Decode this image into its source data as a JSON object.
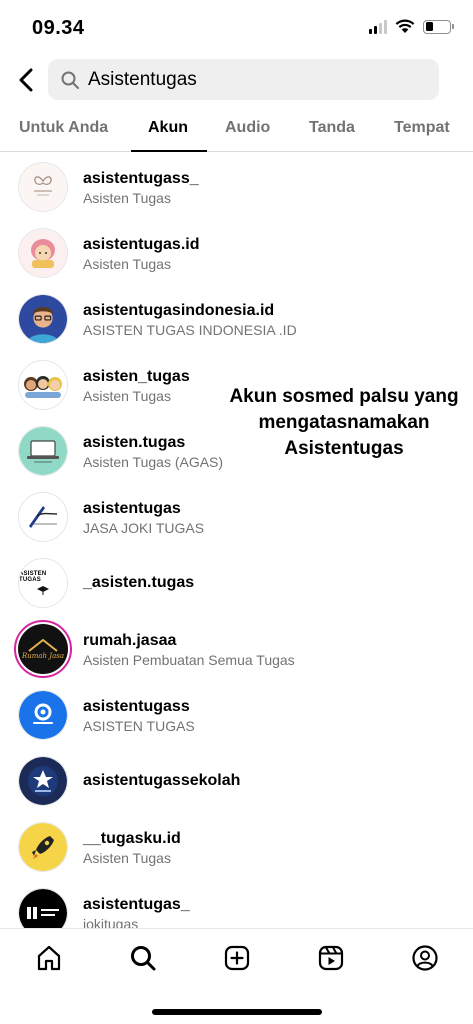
{
  "status_bar": {
    "time": "09.34"
  },
  "search": {
    "query": "Asistentugas"
  },
  "tabs": [
    {
      "label": "Untuk Anda"
    },
    {
      "label": "Akun"
    },
    {
      "label": "Audio"
    },
    {
      "label": "Tanda"
    },
    {
      "label": "Tempat"
    }
  ],
  "results": [
    {
      "username": "asistentugass_",
      "fullname": "Asisten Tugas",
      "avatar_icon": "butterfly-logo-icon"
    },
    {
      "username": "asistentugas.id",
      "fullname": "Asisten Tugas",
      "avatar_icon": "cartoon-girl-icon"
    },
    {
      "username": "asistentugasindonesia.id",
      "fullname": "ASISTEN TUGAS INDONESIA .ID",
      "avatar_icon": "cartoon-man-icon"
    },
    {
      "username": "asisten_tugas",
      "fullname": "Asisten Tugas",
      "avatar_icon": "three-people-icon"
    },
    {
      "username": "asisten.tugas",
      "fullname": "Asisten Tugas (AGAS)",
      "avatar_icon": "laptop-icon"
    },
    {
      "username": "asistentugas",
      "fullname": "JASA JOKI TUGAS",
      "avatar_icon": "pen-logo-icon"
    },
    {
      "username": "_asisten.tugas",
      "fullname": "",
      "avatar_icon": "grad-cap-logo-icon"
    },
    {
      "username": "rumah.jasaa",
      "fullname": "Asisten Pembuatan Semua Tugas",
      "avatar_icon": "house-logo-icon"
    },
    {
      "username": "asistentugass",
      "fullname": "ASISTEN TUGAS",
      "avatar_icon": "blue-circle-logo-icon"
    },
    {
      "username": "asistentugassekolah",
      "fullname": "",
      "avatar_icon": "navy-emblem-icon"
    },
    {
      "username": "__tugasku.id",
      "fullname": "Asisten Tugas",
      "avatar_icon": "rocket-icon"
    },
    {
      "username": "asistentugas_",
      "fullname": "jokitugas",
      "avatar_icon": "black-logo-icon"
    }
  ],
  "annotation": {
    "line1": "Akun sosmed palsu yang",
    "line2": "mengatasnamakan",
    "line3": "Asistentugas"
  },
  "avatar_text": {
    "asisten_tugas_badge": "ASISTEN TUGAS",
    "rumah_jasa_script": "Rumah Jasa"
  },
  "colors": {
    "text_secondary": "#737373",
    "search_bg": "#efeff0",
    "story_ring": "#d6249f"
  }
}
